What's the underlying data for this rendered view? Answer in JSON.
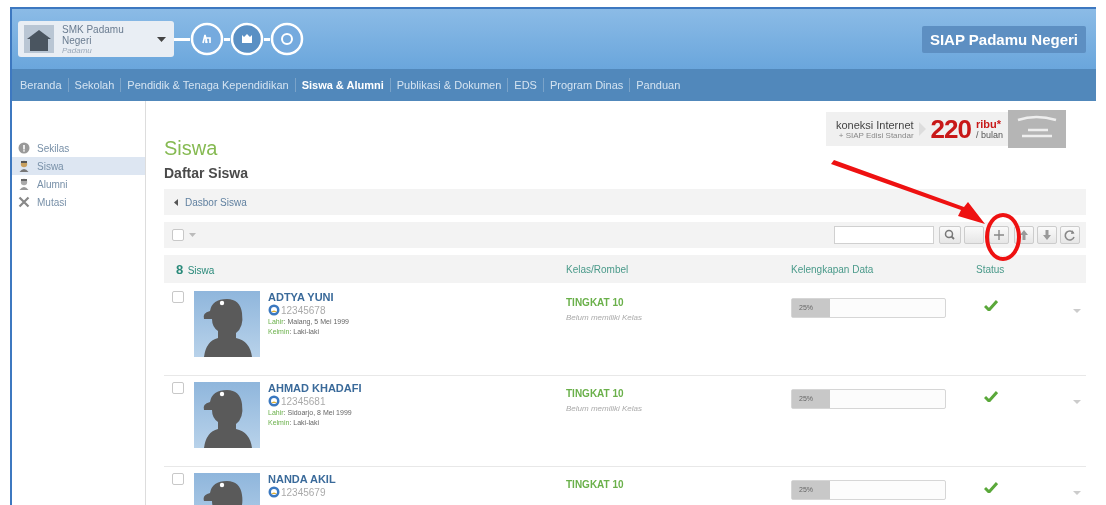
{
  "header": {
    "school": {
      "name": "SMK Padamu Negeri",
      "subtitle": "Padamu"
    },
    "app_title": "SIAP Padamu Negeri"
  },
  "nav": [
    {
      "label": "Beranda",
      "selected": false
    },
    {
      "label": "Sekolah",
      "selected": false
    },
    {
      "label": "Pendidik & Tenaga Kependidikan",
      "selected": false
    },
    {
      "label": "Siswa & Alumni",
      "selected": true
    },
    {
      "label": "Publikasi & Dokumen",
      "selected": false
    },
    {
      "label": "EDS",
      "selected": false
    },
    {
      "label": "Program Dinas",
      "selected": false
    },
    {
      "label": "Panduan",
      "selected": false
    }
  ],
  "sidebar": {
    "items": [
      {
        "label": "Sekilas",
        "kind": "info",
        "selected": false
      },
      {
        "label": "Siswa",
        "kind": "student",
        "selected": true
      },
      {
        "label": "Alumni",
        "kind": "alumni",
        "selected": false
      },
      {
        "label": "Mutasi",
        "kind": "transfer",
        "selected": false
      }
    ]
  },
  "ad": {
    "line1": "koneksi Internet",
    "line2": "+ SIAP Edisi Standar",
    "price": "220",
    "unit": "ribu*",
    "period": "/ bulan"
  },
  "page": {
    "title": "Siswa",
    "subtitle": "Daftar Siswa",
    "breadcrumb": "Dasbor Siswa"
  },
  "toolbar": {
    "select_all_checked": false,
    "buttons": [
      {
        "kind": "search"
      },
      {
        "kind": "blank"
      },
      {
        "kind": "add",
        "highlighted": true
      },
      {
        "kind": "upload"
      },
      {
        "kind": "download"
      },
      {
        "kind": "refresh"
      }
    ]
  },
  "table": {
    "count": "8",
    "count_label": "Siswa",
    "columns": [
      "Kelas/Rombel",
      "Kelengkapan Data",
      "Status"
    ],
    "rows": [
      {
        "checked": false,
        "name": "ADTYA YUNI",
        "id": "12345678",
        "birth_label": "Lahir",
        "birth": ": Malang, 5 Mei 1999",
        "gender_label": "Kelmin",
        "gender": ": Laki-laki",
        "grade": "TINGKAT 10",
        "class_note": "Belum memiliki Kelas",
        "level": 0.25,
        "completeness": "25%",
        "verified": true
      },
      {
        "checked": false,
        "name": "AHMAD KHADAFI",
        "id": "12345681",
        "birth_label": "Lahir",
        "birth": ": Sidoarjo, 8 Mei 1999",
        "gender_label": "Kelmin",
        "gender": ": Laki-laki",
        "grade": "TINGKAT 10",
        "class_note": "Belum memiliki Kelas",
        "level": 0.25,
        "completeness": "25%",
        "verified": true
      },
      {
        "checked": false,
        "name": "NANDA AKIL",
        "id": "12345679",
        "grade": "TINGKAT 10",
        "level": 0.25,
        "completeness": "25%",
        "verified": true
      }
    ]
  }
}
